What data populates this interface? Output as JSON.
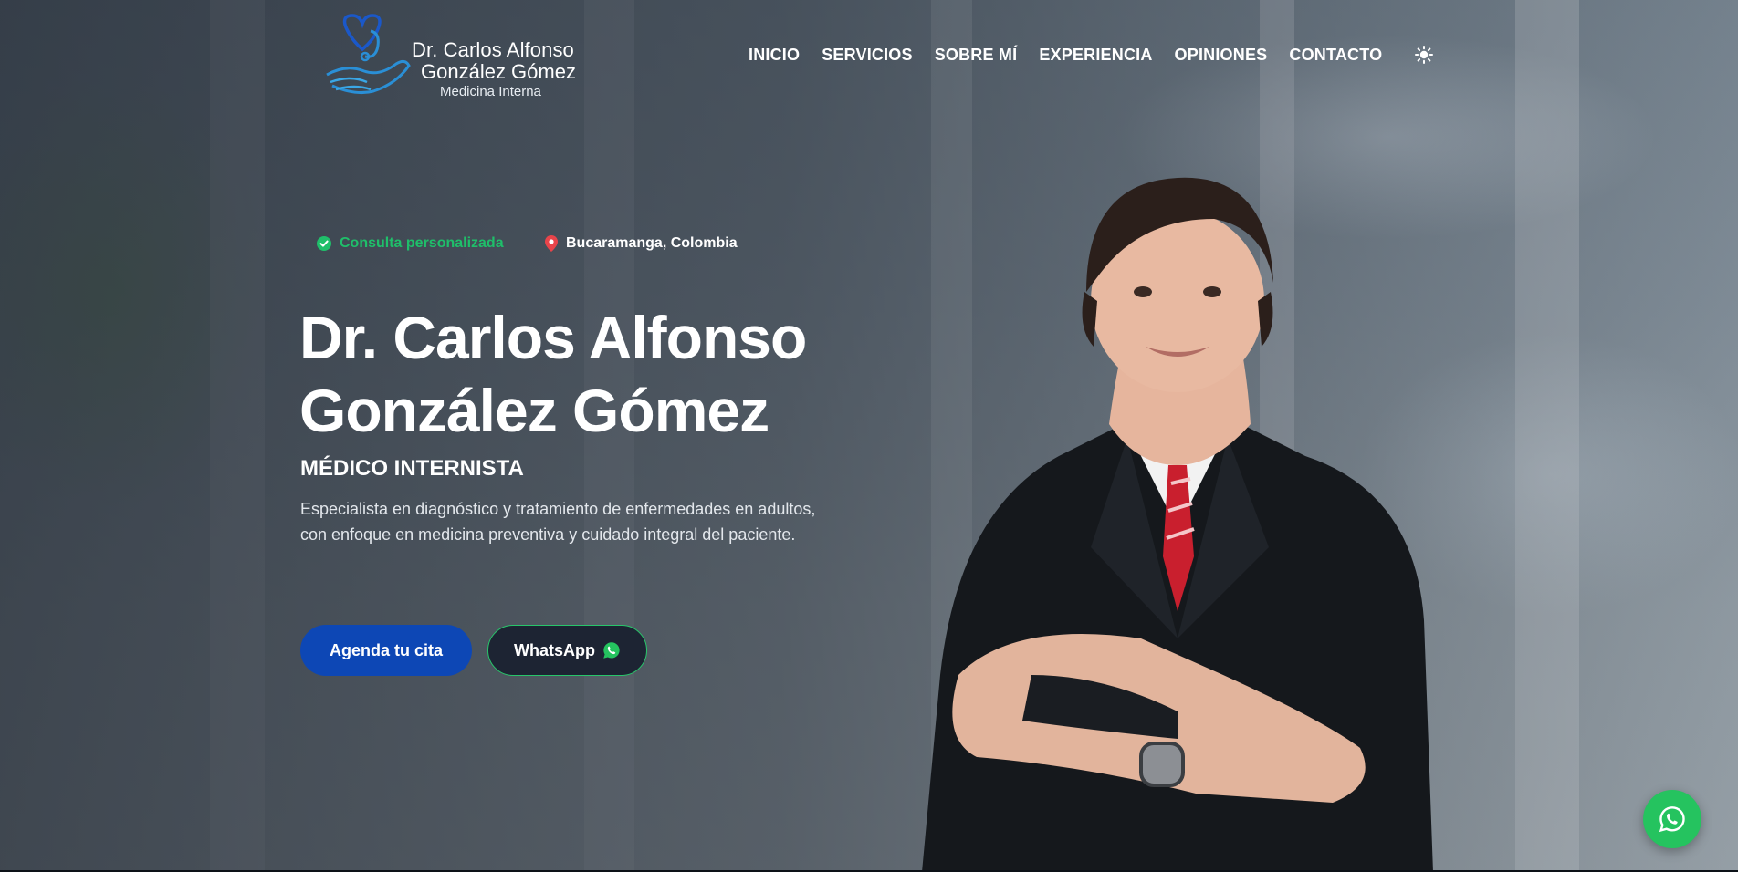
{
  "brand": {
    "name_line1": "Dr. Carlos Alfonso",
    "name_line2": "González Gómez",
    "specialty": "Medicina Interna"
  },
  "nav": {
    "items": [
      {
        "label": "INICIO"
      },
      {
        "label": "SERVICIOS"
      },
      {
        "label": "SOBRE MÍ"
      },
      {
        "label": "EXPERIENCIA"
      },
      {
        "label": "OPINIONES"
      },
      {
        "label": "CONTACTO"
      }
    ],
    "theme_toggle_icon": "sun-icon"
  },
  "hero": {
    "badges": {
      "consult": {
        "label": "Consulta personalizada",
        "icon": "check-circle-icon",
        "color": "#1fbf6a"
      },
      "location": {
        "label": "Bucaramanga, Colombia",
        "icon": "map-pin-icon",
        "color": "#e8444a"
      }
    },
    "title_line1": "Dr. Carlos Alfonso",
    "title_line2": "González Gómez",
    "subtitle": "MÉDICO INTERNISTA",
    "description": "Especialista en diagnóstico y tratamiento de enfermedades en adultos, con enfoque en medicina preventiva y cuidado integral del paciente.",
    "cta_primary": "Agenda tu cita",
    "cta_whatsapp": "WhatsApp",
    "cta_whatsapp_icon": "whatsapp-icon"
  },
  "floating": {
    "whatsapp_icon": "whatsapp-icon"
  },
  "colors": {
    "primary": "#0d47b5",
    "whatsapp": "#25c35f",
    "accent_green": "#1fbf6a",
    "location_red": "#e8444a",
    "logo_blue": "#2a8fd6"
  }
}
